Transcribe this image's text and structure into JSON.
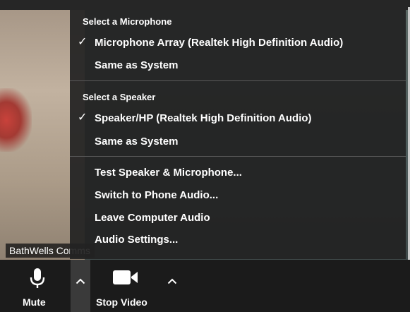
{
  "participant": {
    "name": "BathWells Comms"
  },
  "menu": {
    "microphone_header": "Select a Microphone",
    "microphone_items": [
      {
        "label": "Microphone Array (Realtek High Definition Audio)",
        "checked": true
      },
      {
        "label": "Same as System",
        "checked": false
      }
    ],
    "speaker_header": "Select a Speaker",
    "speaker_items": [
      {
        "label": "Speaker/HP (Realtek High Definition Audio)",
        "checked": true
      },
      {
        "label": "Same as System",
        "checked": false
      }
    ],
    "actions": [
      {
        "label": "Test Speaker & Microphone..."
      },
      {
        "label": "Switch to Phone Audio..."
      },
      {
        "label": "Leave Computer Audio"
      },
      {
        "label": "Audio Settings..."
      }
    ],
    "check_glyph": "✓"
  },
  "toolbar": {
    "mute_label": "Mute",
    "mute_icon": "microphone-icon",
    "stop_video_label": "Stop Video",
    "video_icon": "video-camera-icon"
  }
}
